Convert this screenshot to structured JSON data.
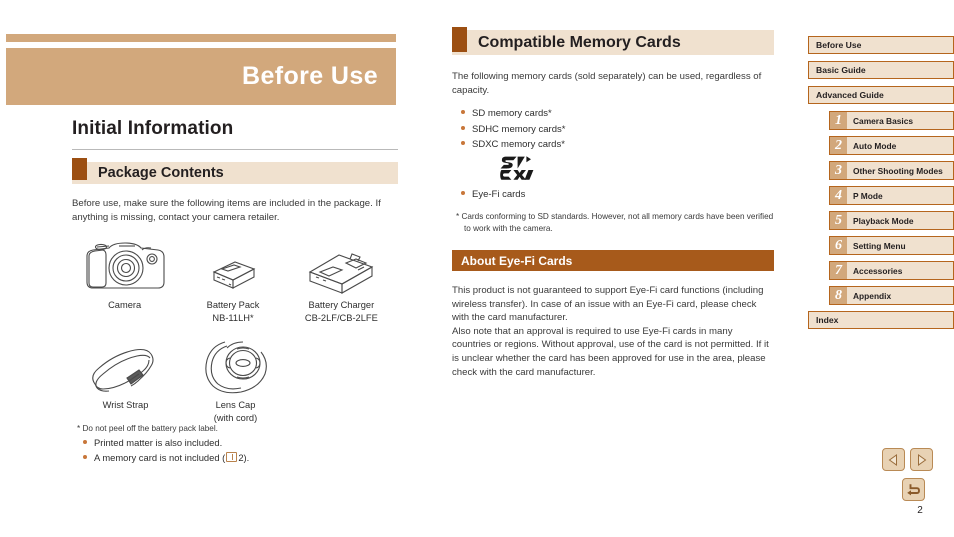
{
  "banner": {
    "title": "Before Use"
  },
  "left": {
    "h1": "Initial Information",
    "section_heading": "Package Contents",
    "intro": "Before use, make sure the following items are included in the package. If anything is missing, contact your camera retailer.",
    "items": [
      {
        "name": "camera-illustration",
        "caption": "Camera"
      },
      {
        "name": "battery-pack-illustration",
        "caption": "Battery Pack\nNB-11LH*"
      },
      {
        "name": "battery-charger-illustration",
        "caption": "Battery Charger\nCB-2LF/CB-2LFE"
      },
      {
        "name": "wrist-strap-illustration",
        "caption": "Wrist Strap"
      },
      {
        "name": "lens-cap-illustration",
        "caption": "Lens Cap\n(with cord)"
      }
    ],
    "footnote": "*  Do not peel off the battery pack label.",
    "bullets": [
      {
        "text": "Printed matter is also included.",
        "has_book_icon": false
      },
      {
        "text_before": "A memory card is not included (",
        "page_ref": "2",
        "text_after": ").",
        "has_book_icon": true
      }
    ]
  },
  "middle": {
    "section_heading": "Compatible Memory Cards",
    "intro": "The following memory cards (sold separately) can be used, regardless of capacity.",
    "card_bullets": [
      "SD memory cards*",
      "SDHC memory cards*",
      "SDXC memory cards*"
    ],
    "logo_label": "SDXC",
    "eyefi_bullet": "Eye-Fi cards",
    "footnote": "*  Cards conforming to SD standards. However, not all memory cards have been verified to work with the camera.",
    "eyefi_heading": "About Eye-Fi Cards",
    "eyefi_paragraph_1": "This product is not guaranteed to support Eye-Fi card functions (including wireless transfer). In case of an issue with an Eye-Fi card, please check with the card manufacturer.",
    "eyefi_paragraph_2": "Also note that an approval is required to use Eye-Fi cards in many countries or regions. Without approval, use of the card is not permitted. If it is unclear whether the card has been approved for use in the area, please check with the card manufacturer."
  },
  "sidebar": {
    "top_items": [
      {
        "label": "Before Use",
        "active": true
      },
      {
        "label": "Basic Guide",
        "active": false
      },
      {
        "label": "Advanced Guide",
        "active": false
      }
    ],
    "chapters": [
      {
        "number": "1",
        "label": "Camera Basics"
      },
      {
        "number": "2",
        "label": "Auto Mode"
      },
      {
        "number": "3",
        "label": "Other Shooting Modes"
      },
      {
        "number": "4",
        "label": "P Mode"
      },
      {
        "number": "5",
        "label": "Playback Mode"
      },
      {
        "number": "6",
        "label": "Setting Menu"
      },
      {
        "number": "7",
        "label": "Accessories"
      },
      {
        "number": "8",
        "label": "Appendix"
      }
    ],
    "index_label": "Index"
  },
  "nav_buttons": {
    "previous": "previous-page-button",
    "next": "next-page-button",
    "back": "back-button"
  },
  "page_number": "2",
  "colors": {
    "banner_tan": "#d2a87c",
    "section_beige": "#f0e1cf",
    "marker_brown": "#9c4f12",
    "band_brown": "#a75a1b",
    "bullet_orange": "#c8773a",
    "nav_border": "#b5651d"
  }
}
